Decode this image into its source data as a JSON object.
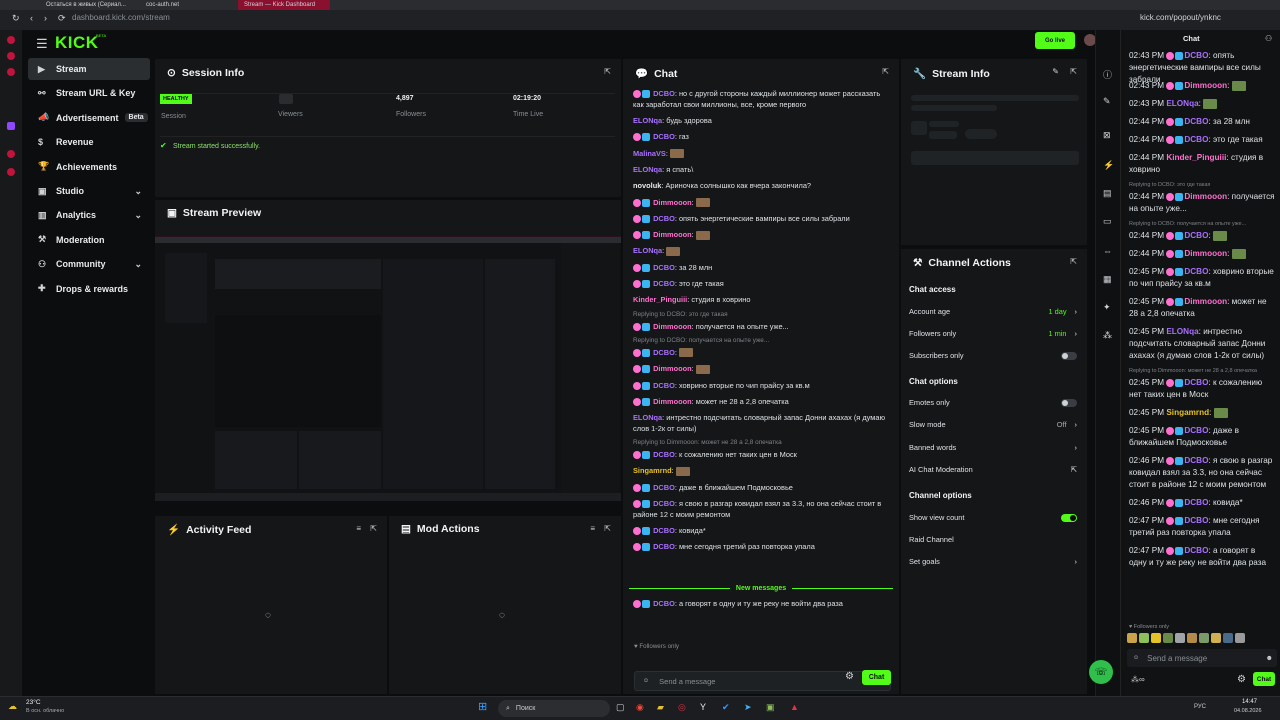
{
  "os": {
    "tabs": [
      "Остаться в живых (Сериал...",
      "coc-auth.net",
      "Stream — Kick Dashboard"
    ],
    "url_left": "dashboard.kick.com/stream",
    "url_right": "kick.com/popout/ynknc"
  },
  "header": {
    "logo": "KICK",
    "logo_beta": "BETA",
    "go_live": "Go live"
  },
  "sidebar": {
    "items": [
      {
        "label": "Stream",
        "icon": "video-icon",
        "active": true
      },
      {
        "label": "Stream URL & Key",
        "icon": "link-icon"
      },
      {
        "label": "Advertisement",
        "icon": "megaphone-icon",
        "badge": "Beta"
      },
      {
        "label": "Revenue",
        "icon": "dollar-icon"
      },
      {
        "label": "Achievements",
        "icon": "trophy-icon"
      },
      {
        "label": "Studio",
        "icon": "studio-icon",
        "chev": true
      },
      {
        "label": "Analytics",
        "icon": "chart-icon",
        "chev": true
      },
      {
        "label": "Moderation",
        "icon": "hammer-icon"
      },
      {
        "label": "Community",
        "icon": "users-icon",
        "chev": true
      },
      {
        "label": "Drops & rewards",
        "icon": "gift-icon"
      }
    ]
  },
  "session": {
    "title": "Session Info",
    "status": "HEALTHY",
    "status_label": "Session",
    "viewers_label": "Viewers",
    "followers_value": "4,897",
    "followers_label": "Followers",
    "time_value": "02:19:20",
    "time_label": "Time Live",
    "message": "Stream started successfully."
  },
  "preview": {
    "title": "Stream Preview"
  },
  "activity": {
    "title": "Activity Feed"
  },
  "modactions": {
    "title": "Mod Actions"
  },
  "chat": {
    "title": "Chat",
    "new_messages": "New messages",
    "followers_only": "Followers only",
    "placeholder": "Send a message",
    "send": "Chat",
    "lines": [
      {
        "user": "DCBO",
        "color": "#a970ff",
        "text": "но с другой стороны каждый миллионер может рассказать как заработал свои миллионы, все, кроме первого",
        "badge": true
      },
      {
        "user": "ELONqa",
        "color": "#a970ff",
        "text": "будь здорова"
      },
      {
        "user": "DCBO",
        "color": "#a970ff",
        "text": "газ",
        "badge": true
      },
      {
        "user": "MalinaVS",
        "color": "#a970ff",
        "text": ""
      },
      {
        "user": "ELONqa",
        "color": "#a970ff",
        "text": "я спать\\"
      },
      {
        "user": "novoluk",
        "color": "#e8eaec",
        "text": "Ариночка солнышко как вчера закончила?"
      },
      {
        "user": "Dimmooon",
        "color": "#ff6fcf",
        "text": "",
        "badge": true
      },
      {
        "user": "DCBO",
        "color": "#a970ff",
        "text": "опять энергетические вампиры все силы забрали",
        "badge": true
      },
      {
        "user": "Dimmooon",
        "color": "#ff6fcf",
        "text": "",
        "badge": true
      },
      {
        "user": "ELONqa",
        "color": "#a970ff",
        "text": ""
      },
      {
        "user": "DCBO",
        "color": "#a970ff",
        "text": "за 28 млн",
        "badge": true
      },
      {
        "user": "DCBO",
        "color": "#a970ff",
        "text": "это где такая",
        "badge": true
      },
      {
        "user": "Kinder_Pinguiii",
        "color": "#ff6fcf",
        "text": "студия в ховрино"
      },
      {
        "reply": "Replying to DCBO: это где такая"
      },
      {
        "user": "Dimmooon",
        "color": "#ff6fcf",
        "text": "получается на опыте уже...",
        "badge": true
      },
      {
        "reply": "Replying to DCBO: получается на опыте уже..."
      },
      {
        "user": "DCBO",
        "color": "#a970ff",
        "text": "",
        "badge": true
      },
      {
        "user": "Dimmooon",
        "color": "#ff6fcf",
        "text": "",
        "badge": true
      },
      {
        "user": "DCBO",
        "color": "#a970ff",
        "text": "ховрино вторые по чип прайсу за кв.м",
        "badge": true
      },
      {
        "user": "Dimmooon",
        "color": "#ff6fcf",
        "text": "может не 28 а 2,8 опечатка",
        "badge": true
      },
      {
        "user": "ELONqa",
        "color": "#a970ff",
        "text": "интрестно подсчитать словарный запас Донни ахахах (я думаю слов 1-2к от силы)"
      },
      {
        "reply": "Replying to Dimmooon: может не 28 а 2,8 опечатка"
      },
      {
        "user": "DCBO",
        "color": "#a970ff",
        "text": "к сожалению нет таких цен в Моск",
        "badge": true
      },
      {
        "user": "Singamrnd",
        "color": "#e6c229",
        "text": ""
      },
      {
        "user": "DCBO",
        "color": "#a970ff",
        "text": "даже в ближайшем Подмосковье",
        "badge": true
      },
      {
        "user": "DCBO",
        "color": "#a970ff",
        "text": "я свою в разгар ковидал взял за 3.3, но она сейчас стоит в районе 12 с моим ремонтом",
        "badge": true
      },
      {
        "user": "DCBO",
        "color": "#a970ff",
        "text": "ковида*",
        "badge": true
      },
      {
        "user": "DCBO",
        "color": "#a970ff",
        "text": "мне сегодня третий раз повторка упала",
        "badge": true
      }
    ],
    "after": {
      "user": "DCBO",
      "text": "а говорят в одну и ту же реку не войти два раза"
    }
  },
  "streaminfo": {
    "title": "Stream Info"
  },
  "channel": {
    "title": "Channel Actions",
    "access_head": "Chat access",
    "account_age": "Account age",
    "account_age_val": "1 day",
    "followers_only": "Followers only",
    "followers_only_val": "1 min",
    "subs_only": "Subscribers only",
    "options_head": "Chat options",
    "emotes_only": "Emotes only",
    "slow_mode": "Slow mode",
    "slow_mode_val": "Off",
    "banned_words": "Banned words",
    "ai_mod": "AI Chat Moderation",
    "chan_head": "Channel options",
    "view_count": "Show view count",
    "raid": "Raid Channel",
    "goals": "Set goals"
  },
  "popup": {
    "title": "Chat",
    "followers_only": "Followers only",
    "placeholder": "Send a message",
    "send": "Chat",
    "lines": [
      {
        "time": "02:43 PM",
        "user": "DCBO",
        "color": "#a970ff",
        "text": "опять энергетические вампиры все силы забрали",
        "badge": true
      },
      {
        "time": "02:43 PM",
        "user": "Dimmooon",
        "color": "#ff6fcf",
        "text": "",
        "badge": true
      },
      {
        "time": "02:43 PM",
        "user": "ELONqa",
        "color": "#a970ff",
        "text": ""
      },
      {
        "time": "02:44 PM",
        "user": "DCBO",
        "color": "#a970ff",
        "text": "за 28 млн",
        "badge": true
      },
      {
        "time": "02:44 PM",
        "user": "DCBO",
        "color": "#a970ff",
        "text": "это где такая",
        "badge": true
      },
      {
        "time": "02:44 PM",
        "user": "Kinder_Pinguiii",
        "color": "#ff6fcf",
        "text": "студия в ховрино"
      },
      {
        "reply": "Replying to DCBO: это где такая"
      },
      {
        "time": "02:44 PM",
        "user": "Dimmooon",
        "color": "#ff6fcf",
        "text": "получается на опыте уже...",
        "badge": true
      },
      {
        "reply": "Replying to DCBO: получается на опыте уже..."
      },
      {
        "time": "02:44 PM",
        "user": "DCBO",
        "color": "#a970ff",
        "text": "",
        "badge": true
      },
      {
        "time": "02:44 PM",
        "user": "Dimmooon",
        "color": "#ff6fcf",
        "text": "",
        "badge": true
      },
      {
        "time": "02:45 PM",
        "user": "DCBO",
        "color": "#a970ff",
        "text": "ховрино вторые по чип прайсу за кв.м",
        "badge": true
      },
      {
        "time": "02:45 PM",
        "user": "Dimmooon",
        "color": "#ff6fcf",
        "text": "может не 28 а 2,8 опечатка",
        "badge": true
      },
      {
        "time": "02:45 PM",
        "user": "ELONqa",
        "color": "#a970ff",
        "text": "интрестно подсчитать словарный запас Донни ахахах (я думаю слов 1-2к от силы)"
      },
      {
        "reply": "Replying to Dimmooon: может не 28 а 2,8 опечатка"
      },
      {
        "time": "02:45 PM",
        "user": "DCBO",
        "color": "#a970ff",
        "text": "к сожалению нет таких цен в Моск",
        "badge": true
      },
      {
        "time": "02:45 PM",
        "user": "Singamrnd",
        "color": "#e6c229",
        "text": ""
      },
      {
        "time": "02:45 PM",
        "user": "DCBO",
        "color": "#a970ff",
        "text": "даже в ближайшем Подмосковье",
        "badge": true
      },
      {
        "time": "02:46 PM",
        "user": "DCBO",
        "color": "#a970ff",
        "text": "я свою в разгар ковидал взял за 3.3, но она сейчас стоит в районе 12 с моим ремонтом",
        "badge": true
      },
      {
        "time": "02:46 PM",
        "user": "DCBO",
        "color": "#a970ff",
        "text": "ковида*",
        "badge": true
      },
      {
        "time": "02:47 PM",
        "user": "DCBO",
        "color": "#a970ff",
        "text": "мне сегодня третий раз повторка упала",
        "badge": true
      },
      {
        "time": "02:47 PM",
        "user": "DCBO",
        "color": "#a970ff",
        "text": "а говорят в одну и ту же реку не войти два раза",
        "badge": true
      }
    ]
  },
  "taskbar": {
    "weather_temp": "23°C",
    "weather_desc": "В осн. облачно",
    "search": "Поиск",
    "lang": "РУС",
    "time": "14:47",
    "date": "04.08.2026"
  },
  "colors": {
    "accent": "#53fc18",
    "purple": "#a970ff",
    "pink": "#ff6fcf"
  }
}
